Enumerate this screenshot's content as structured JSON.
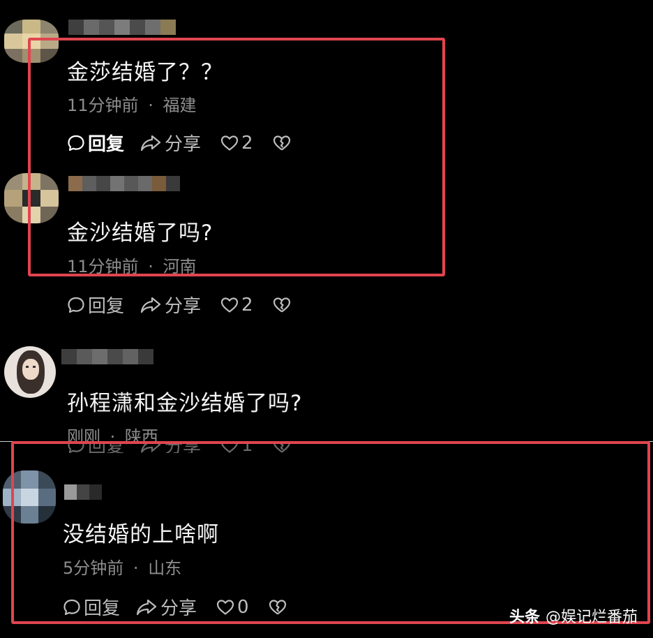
{
  "comments": [
    {
      "text": "金莎结婚了？？",
      "time": "11分钟前",
      "location": "福建",
      "reply_label": "回复",
      "share_label": "分享",
      "like_count": "2"
    },
    {
      "text": "金沙结婚了吗?",
      "time": "11分钟前",
      "location": "河南",
      "reply_label": "回复",
      "share_label": "分享",
      "like_count": "2"
    },
    {
      "text": "孙程潇和金沙结婚了吗?",
      "time": "刚刚",
      "location": "陕西",
      "reply_label": "回复",
      "share_label": "分享",
      "like_count": "1"
    },
    {
      "text": "没结婚的上啥啊",
      "time": "5分钟前",
      "location": "山东",
      "reply_label": "回复",
      "share_label": "分享",
      "like_count": "0"
    }
  ],
  "meta_separator": "·",
  "watermark": {
    "brand": "头条",
    "account": "@娱记烂番茄"
  },
  "colors": {
    "background": "#000000",
    "highlight_box": "#e0454f",
    "meta_text": "#8d8d8d"
  },
  "icons": [
    "comment-bubble-icon",
    "share-arrow-icon",
    "heart-icon",
    "broken-heart-icon"
  ]
}
